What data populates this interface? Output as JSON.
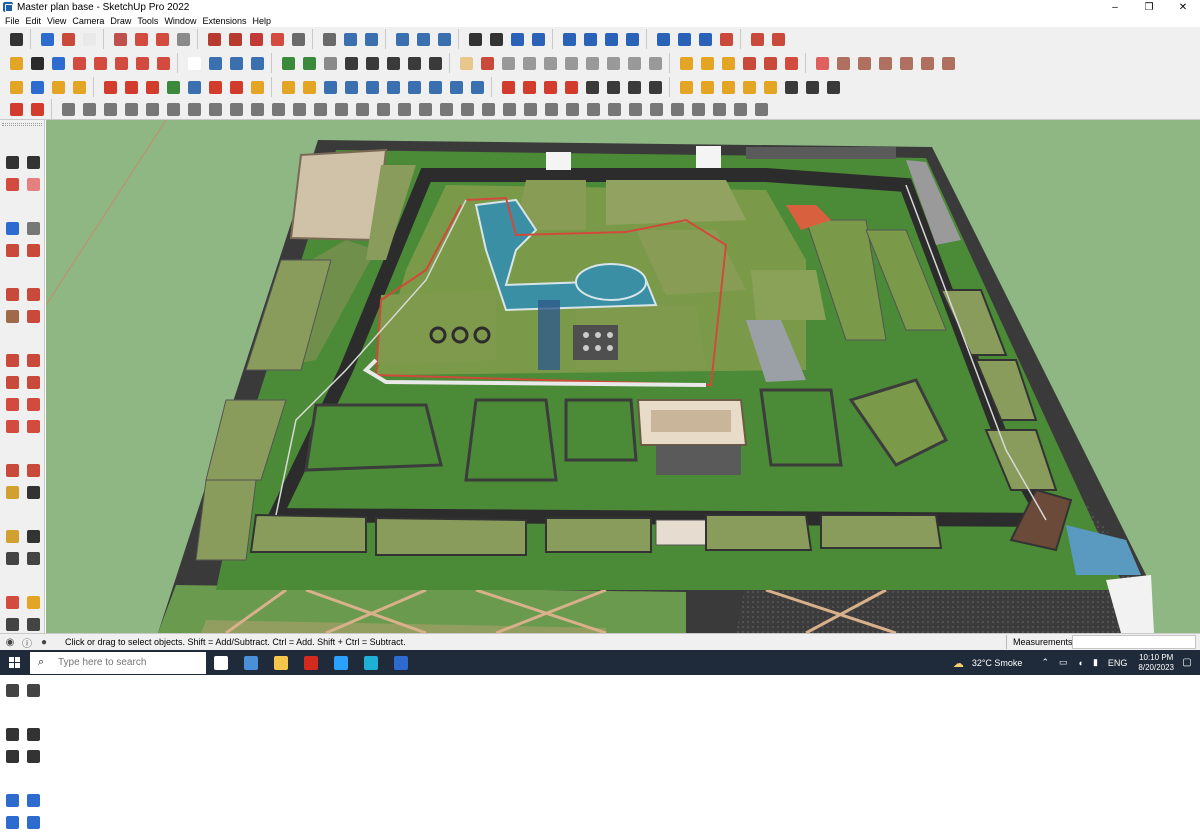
{
  "window": {
    "title": "Master plan base - SketchUp Pro 2022",
    "minimize": "–",
    "maximize": "❐",
    "close": "✕"
  },
  "menu": [
    "File",
    "Edit",
    "View",
    "Camera",
    "Draw",
    "Tools",
    "Window",
    "Extensions",
    "Help"
  ],
  "statusbar": {
    "hint": "Click or drag to select objects. Shift = Add/Subtract. Ctrl = Add. Shift + Ctrl = Subtract.",
    "measurements_label": "Measurements",
    "measurements_value": ""
  },
  "taskbar": {
    "search_placeholder": "Type here to search",
    "weather": "32°C  Smoke",
    "language": "ENG",
    "time": "10:10 PM",
    "date": "8/20/2023",
    "apps": [
      "task-view-icon",
      "calculator-icon",
      "file-explorer-icon",
      "acrobat-icon",
      "photoshop-icon",
      "edge-icon",
      "sketchup-icon"
    ]
  },
  "toolbar": {
    "row1": [
      "#333",
      "#2d6bcf",
      "#c94a3a",
      "#e9e9e9",
      "#c0504d",
      "#d24b3e",
      "#d24b3e",
      "#8a8a8a",
      "#b63a30",
      "#b63a30",
      "#c23a35",
      "#d24b3e",
      "#6a6a6a",
      "#6a6a6a",
      "#3a6fb0",
      "#3a6fb0",
      "#3a6fb0",
      "#3a6fb0",
      "#3a6fb0",
      "#333",
      "#333",
      "#2a62b8",
      "#2a62b8",
      "#2a62b8",
      "#2a62b8",
      "#2a62b8",
      "#2a62b8",
      "#2a62b8",
      "#2a62b8",
      "#2a62b8",
      "#c94a3a",
      "#c94a3a",
      "#c94a3a"
    ],
    "row2": [
      "#e4a524",
      "#2b2b2b",
      "#2d6bcf",
      "#d24b3e",
      "#d24b3e",
      "#d24b3e",
      "#d24b3e",
      "#d24b3e",
      "#ffffff",
      "#3a6fb0",
      "#3a6fb0",
      "#3a6fb0",
      "#3b8a3b",
      "#3b8a3b",
      "#8a8a8a",
      "#3a3a3a",
      "#3a3a3a",
      "#3a3a3a",
      "#3a3a3a",
      "#3a3a3a",
      "#e8c88a",
      "#c94a3a",
      "#999",
      "#999",
      "#999",
      "#999",
      "#999",
      "#999",
      "#999",
      "#999",
      "#e4a524",
      "#e4a524",
      "#e4a524",
      "#c94a3a",
      "#c94a3a",
      "#d24b3e",
      "#e06060",
      "#b07060",
      "#b07060",
      "#b07060",
      "#b07060",
      "#b07060",
      "#b07060"
    ],
    "row3": [
      "#e4a524",
      "#2d6bcf",
      "#e4a524",
      "#e4a524",
      "#d23c2c",
      "#d23c2c",
      "#d23c2c",
      "#3b8a3b",
      "#3a6fb0",
      "#d23c2c",
      "#d23c2c",
      "#e4a524",
      "#e4a524",
      "#e4a524",
      "#3a6fb0",
      "#3a6fb0",
      "#3a6fb0",
      "#3a6fb0",
      "#3a6fb0",
      "#3a6fb0",
      "#3a6fb0",
      "#3a6fb0",
      "#d23c2c",
      "#d23c2c",
      "#d23c2c",
      "#d23c2c",
      "#3a3a3a",
      "#3a3a3a",
      "#3a3a3a",
      "#3a3a3a",
      "#e4a524",
      "#e4a524",
      "#e4a524",
      "#e4a524",
      "#e4a524",
      "#3a3a3a",
      "#3a3a3a",
      "#3a3a3a"
    ],
    "row4": [
      "#d23c2c",
      "#d23c2c",
      "#777",
      "#777",
      "#777",
      "#777",
      "#777",
      "#777",
      "#777",
      "#777",
      "#777",
      "#777",
      "#777",
      "#777",
      "#777",
      "#777",
      "#777",
      "#777",
      "#777",
      "#777",
      "#777",
      "#777",
      "#777",
      "#777",
      "#777",
      "#777",
      "#777",
      "#777",
      "#777",
      "#777",
      "#777",
      "#777",
      "#777",
      "#777",
      "#777",
      "#777"
    ],
    "left": [
      "#333",
      "#333",
      "#d24b3e",
      "#e48080",
      "#2d6bcf",
      "#777",
      "#c94a3a",
      "#c94a3a",
      "#c94a3a",
      "#c94a3a",
      "#a06a4a",
      "#c94a3a",
      "#c94a3a",
      "#c94a3a",
      "#c94a3a",
      "#c94a3a",
      "#d24b3e",
      "#d24b3e",
      "#d24b3e",
      "#d24b3e",
      "#c94a3a",
      "#c94a3a",
      "#d2a030",
      "#333",
      "#d2a030",
      "#333",
      "#444",
      "#444",
      "#d24b3e",
      "#e4a524",
      "#444",
      "#444",
      "#444",
      "#444",
      "#444",
      "#444",
      "#333",
      "#333",
      "#333",
      "#333",
      "#2d6bcf",
      "#2d6bcf",
      "#2d6bcf",
      "#2d6bcf"
    ]
  }
}
